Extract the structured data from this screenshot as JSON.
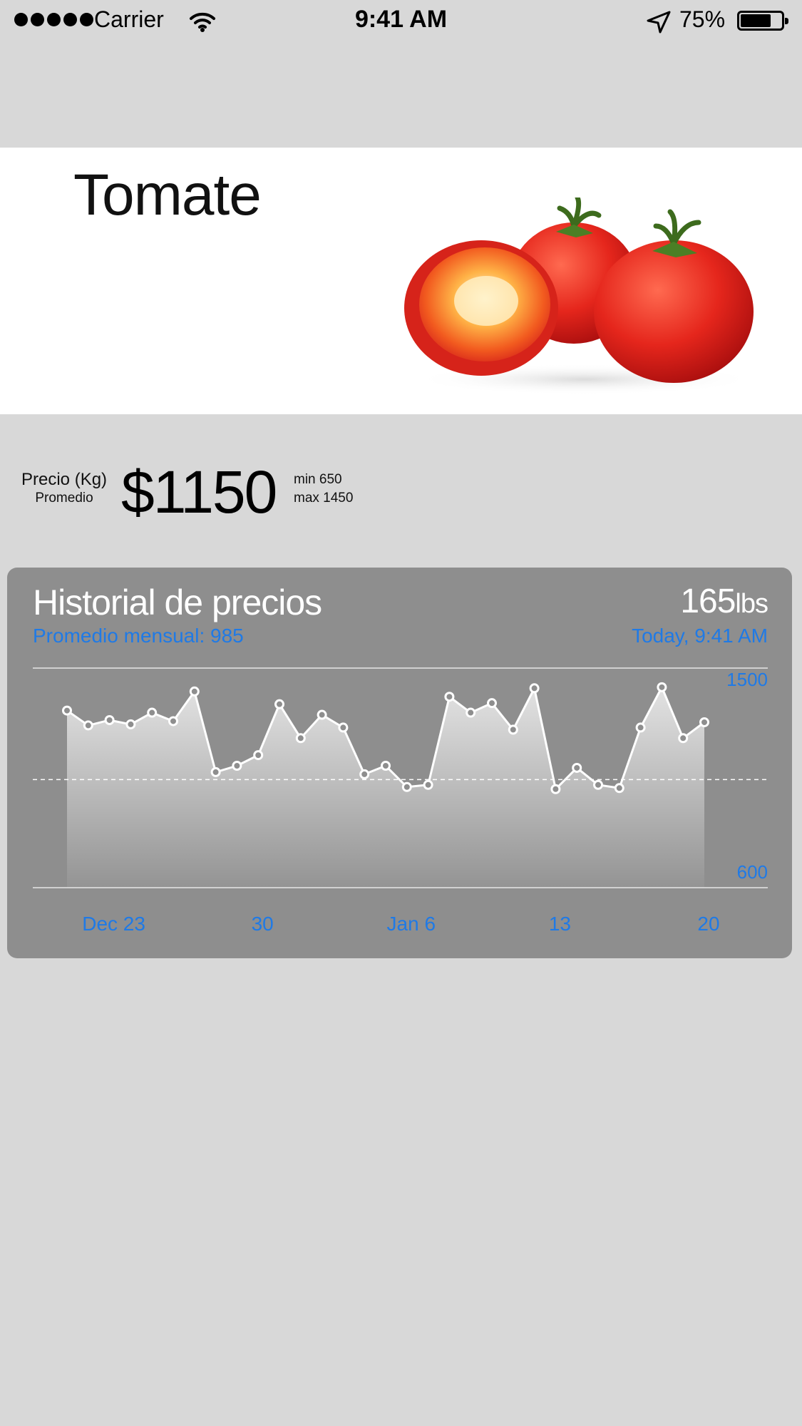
{
  "status_bar": {
    "carrier": "Carrier",
    "time": "9:41 AM",
    "battery_percent": "75%",
    "battery_level": 0.75,
    "icons": [
      "signal-dots-icon",
      "wifi-icon",
      "location-arrow-icon",
      "battery-icon"
    ]
  },
  "product": {
    "name": "Tomate",
    "image_icon": "tomato-image"
  },
  "price": {
    "label": "Precio (Kg)",
    "sublabel": "Promedio",
    "value": "$1150",
    "min": "min 650",
    "max": "max 1450"
  },
  "history": {
    "title": "Historial de precios",
    "weight_value": "165",
    "weight_unit": "lbs",
    "monthly_average": "Promedio mensual: 985",
    "timestamp": "Today, 9:41 AM",
    "colors": {
      "card": "#8e8e8e",
      "accent": "#1f7ae6",
      "line": "#ffffff"
    }
  },
  "chart_data": {
    "type": "area",
    "title": "Historial de precios",
    "y_tick_labels": [
      "1500",
      "600"
    ],
    "ylim": [
      600,
      1500
    ],
    "x_tick_labels": [
      "Dec 23",
      "30",
      "Jan 6",
      "13",
      "20"
    ],
    "x_tick_indices": [
      2,
      9,
      16,
      23,
      30
    ],
    "reference_line": 985,
    "grid": false,
    "values": [
      1310,
      1240,
      1265,
      1245,
      1300,
      1260,
      1400,
      1020,
      1050,
      1100,
      1340,
      1180,
      1290,
      1230,
      1010,
      1050,
      950,
      960,
      1375,
      1300,
      1345,
      1220,
      1415,
      940,
      1040,
      960,
      945,
      1230,
      1420,
      1180,
      1255
    ]
  }
}
